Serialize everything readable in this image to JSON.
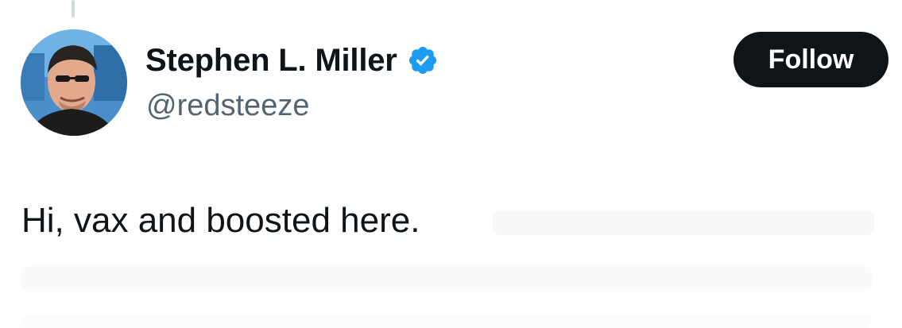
{
  "tweet": {
    "author": {
      "display_name": "Stephen L. Miller",
      "handle": "@redsteeze",
      "verified": true,
      "verified_color": "#1d9bf0"
    },
    "follow_label": "Follow",
    "text_visible": "Hi, vax and boosted here."
  },
  "colors": {
    "text": "#0f1419",
    "secondary_text": "#536471",
    "button_bg": "#0f1419",
    "button_text": "#ffffff",
    "thread_line": "#cfd9de"
  },
  "icons": [
    "avatar-image",
    "verified-badge-icon"
  ]
}
